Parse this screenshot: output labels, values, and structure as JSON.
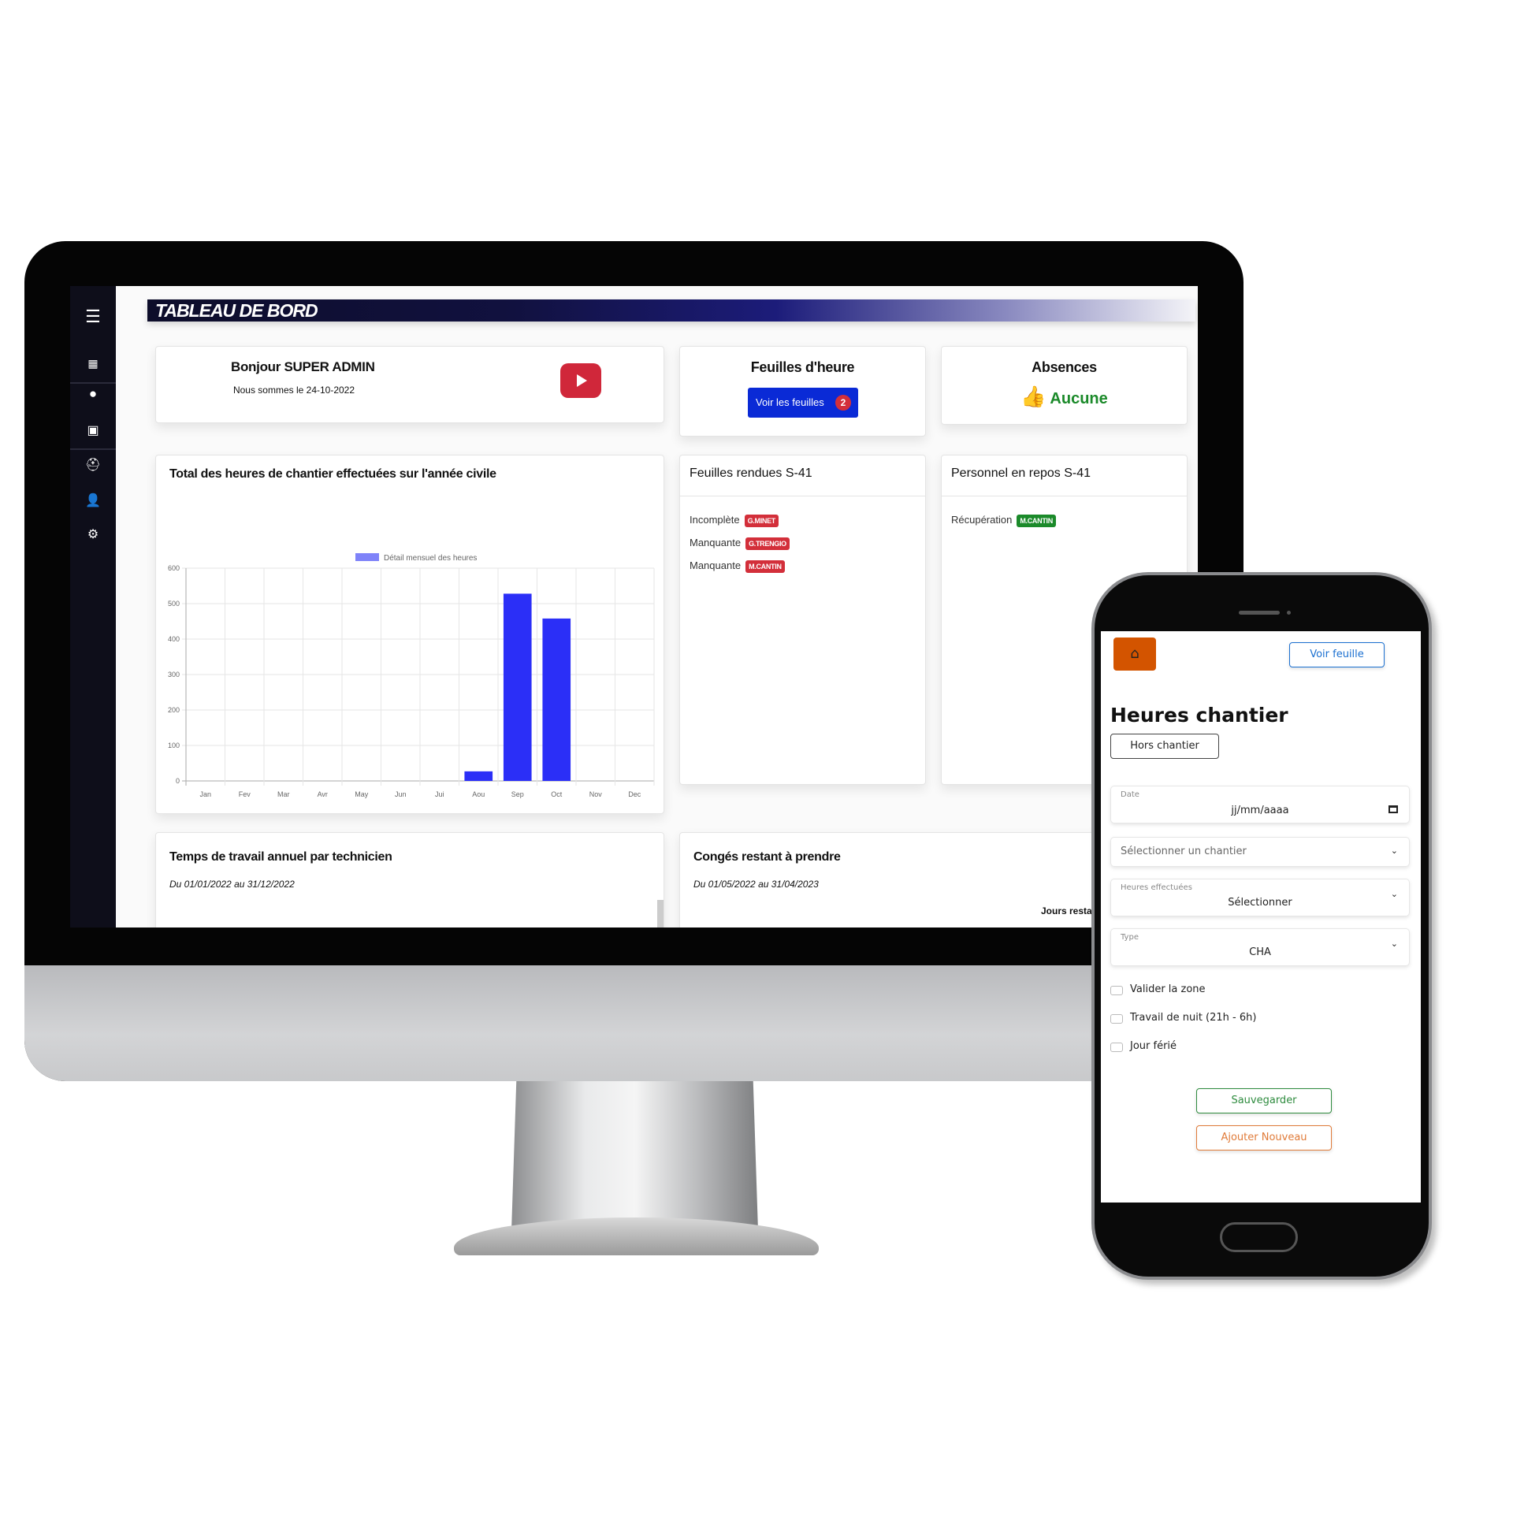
{
  "dashboard": {
    "title": "TABLEAU DE BORD",
    "sidebar": {
      "items": [
        {
          "icon": "menu-icon"
        },
        {
          "icon": "dashboard-grid-icon"
        },
        {
          "icon": "clock-icon"
        },
        {
          "icon": "trailer-icon"
        },
        {
          "icon": "hard-hat-icon"
        },
        {
          "icon": "user-check-icon"
        },
        {
          "icon": "gear-icon"
        }
      ]
    },
    "welcome": {
      "title": "Bonjour SUPER ADMIN",
      "date_text": "Nous sommes le 24-10-2022",
      "video_icon": "youtube-play-icon"
    },
    "timesheets": {
      "title": "Feuilles d'heure",
      "button_label": "Voir les feuilles",
      "count": "2"
    },
    "absences": {
      "title": "Absences",
      "value": "Aucune",
      "icon": "thumbs-up-icon"
    },
    "submitted": {
      "title": "Feuilles rendues S-41",
      "rows": [
        {
          "status": "Incomplète",
          "name": "G.MINET"
        },
        {
          "status": "Manquante",
          "name": "G.TRENGIO"
        },
        {
          "status": "Manquante",
          "name": "M.CANTIN"
        }
      ]
    },
    "rest": {
      "title": "Personnel en repos S-41",
      "rows": [
        {
          "status": "Récupération",
          "name": "M.CANTIN"
        }
      ]
    },
    "annual": {
      "title": "Temps de travail annuel par technicien",
      "period": "Du 01/01/2022 au 31/12/2022"
    },
    "leave": {
      "title": "Congés restant à prendre",
      "period": "Du 01/05/2022 au 31/04/2023",
      "column": "Jours restar"
    },
    "colors": {
      "red_badge": "#d32f3a",
      "green_badge": "#1b8a2a",
      "button_blue": "#0a2ad6",
      "bar": "#2b2ff7",
      "thumb_green": "#1b8a2a"
    }
  },
  "chart_data": {
    "type": "bar",
    "title": "Total des heures de chantier effectuées sur l'année civile",
    "legend": "Détail mensuel des heures",
    "legend_position": "top",
    "categories": [
      "Jan",
      "Fev",
      "Mar",
      "Avr",
      "May",
      "Jun",
      "Jui",
      "Aou",
      "Sep",
      "Oct",
      "Nov",
      "Dec"
    ],
    "series": [
      {
        "name": "Détail mensuel des heures",
        "values": [
          0,
          0,
          0,
          0,
          0,
          0,
          0,
          27,
          528,
          458,
          0,
          0
        ]
      }
    ],
    "yticks": [
      "0",
      "100",
      "200",
      "300",
      "400",
      "500",
      "600"
    ],
    "ylim": [
      0,
      600
    ],
    "grid": true
  },
  "phone": {
    "home_icon": "home-icon",
    "view_button": "Voir feuille",
    "title": "Heures chantier",
    "toggle_button": "Hors chantier",
    "date": {
      "label": "Date",
      "placeholder": "jj/mm/aaaa"
    },
    "site_select": "Sélectionner un chantier",
    "hours": {
      "label": "Heures effectuées",
      "value": "Sélectionner"
    },
    "type": {
      "label": "Type",
      "value": "CHA"
    },
    "checkboxes": [
      "Valider la zone",
      "Travail de nuit (21h - 6h)",
      "Jour férié"
    ],
    "save_button": "Sauvegarder",
    "add_button": "Ajouter Nouveau"
  }
}
